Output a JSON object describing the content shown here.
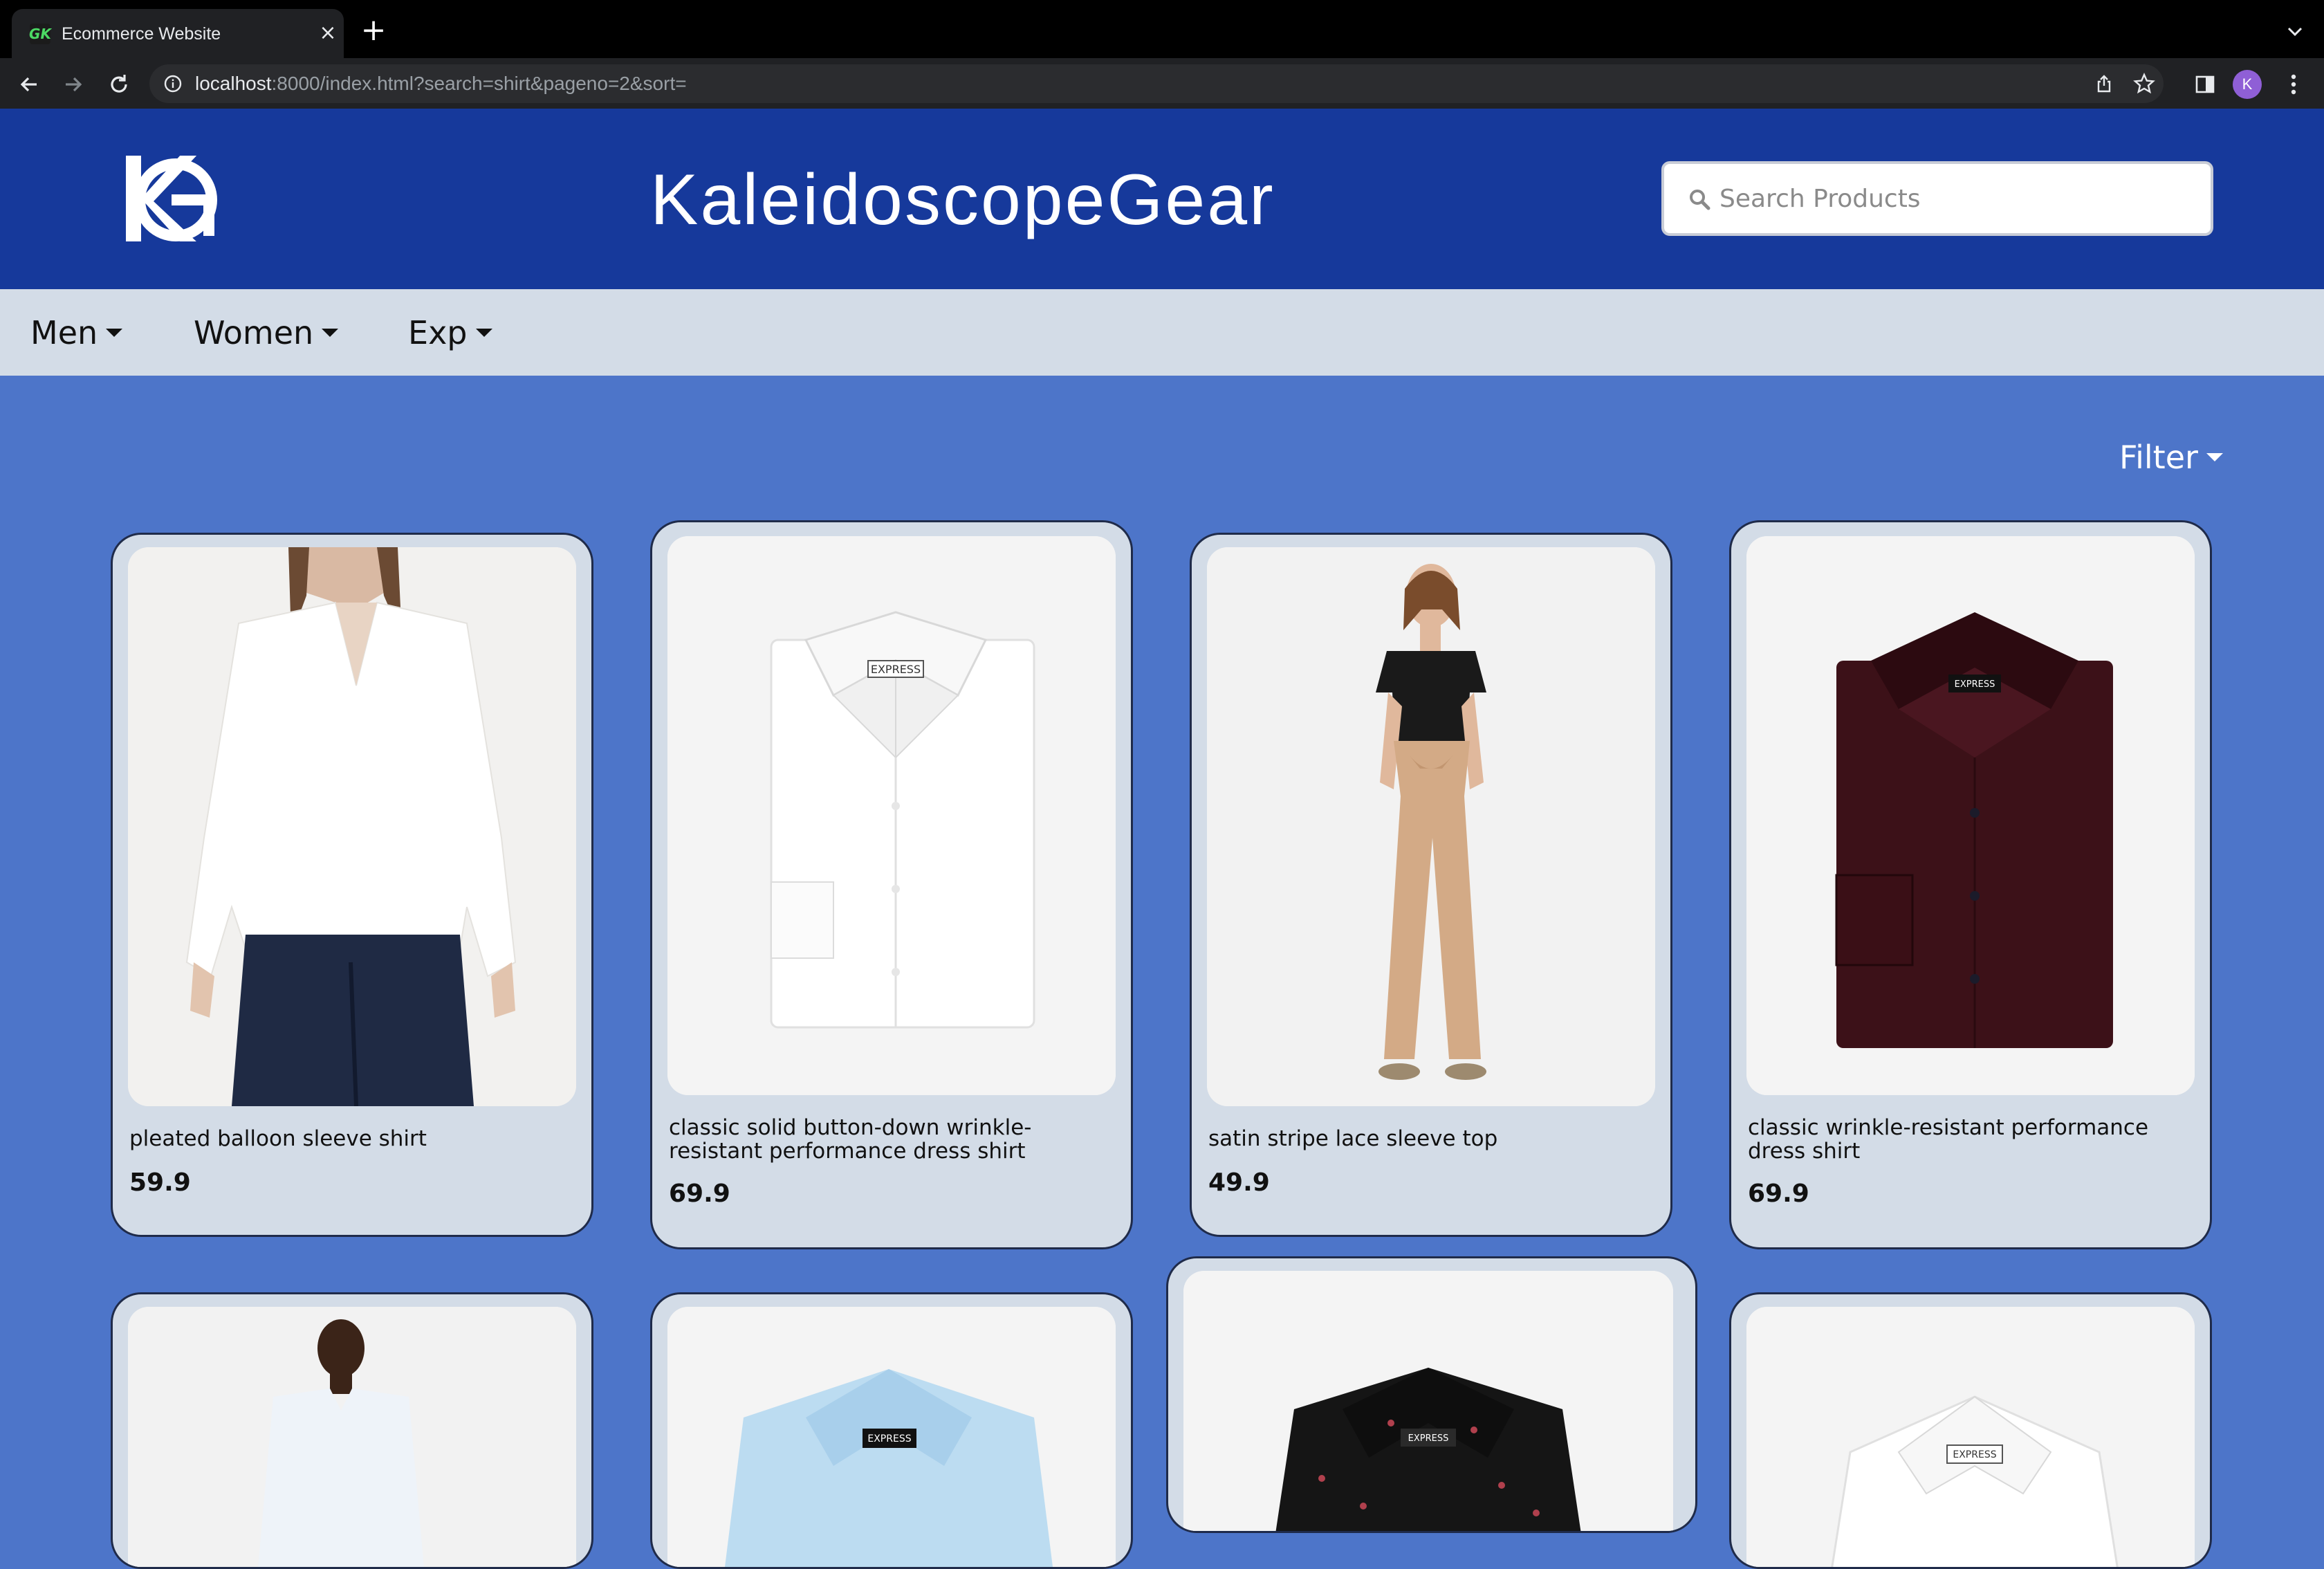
{
  "browser": {
    "tab_title": "Ecommerce Website",
    "favicon_text": "GK",
    "url_host": "localhost",
    "url_rest": ":8000/index.html?search=shirt&pageno=2&sort=",
    "profile_initial": "K"
  },
  "header": {
    "brand": "KaleidoscopeGear",
    "search_placeholder": "Search Products"
  },
  "nav": {
    "items": [
      {
        "label": "Men"
      },
      {
        "label": "Women"
      },
      {
        "label": "Exp"
      }
    ]
  },
  "filter": {
    "label": "Filter"
  },
  "products": [
    {
      "name": "pleated balloon sleeve shirt",
      "price": "59.9",
      "image": "white-blouse"
    },
    {
      "name": "classic solid button-down wrinkle-resistant performance dress shirt",
      "price": "69.9",
      "image": "white-dress-shirt"
    },
    {
      "name": "satin stripe lace sleeve top",
      "price": "49.9",
      "image": "black-lace-top"
    },
    {
      "name": "classic wrinkle-resistant performance dress shirt",
      "price": "69.9",
      "image": "burgundy-dress-shirt"
    },
    {
      "name": "",
      "price": "",
      "image": "man-white-shirt"
    },
    {
      "name": "",
      "price": "",
      "image": "light-blue-shirt"
    },
    {
      "name": "",
      "price": "",
      "image": "black-print-shirt"
    },
    {
      "name": "",
      "price": "",
      "image": "white-shirt"
    }
  ],
  "colors": {
    "header_bg": "#16399b",
    "page_bg": "#4d75c9",
    "card_bg": "#d3dce7",
    "nav_bg": "#d3dce7"
  }
}
